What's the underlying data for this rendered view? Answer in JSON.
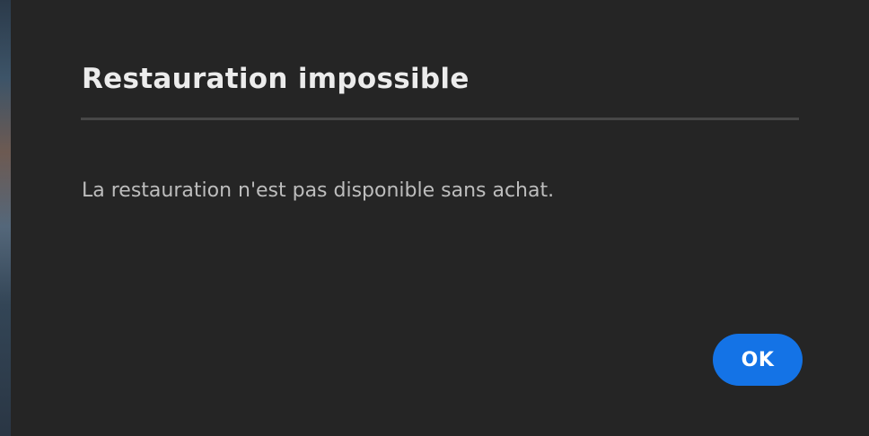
{
  "dialog": {
    "title": "Restauration impossible",
    "message": "La restauration n'est pas disponible sans achat.",
    "ok_label": "OK"
  },
  "colors": {
    "dialog_background": "#252525",
    "title_text": "#ececec",
    "message_text": "#bdbdbd",
    "divider": "#474747",
    "accent_button": "#1473e6"
  }
}
